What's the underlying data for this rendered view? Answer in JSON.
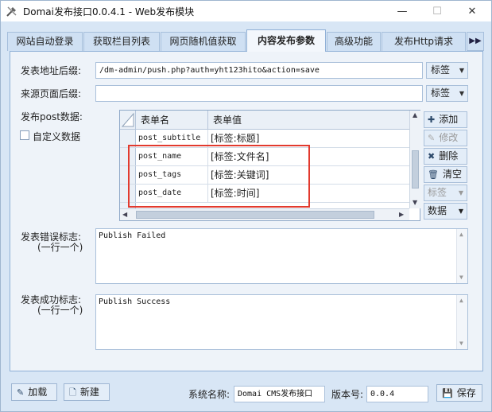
{
  "window": {
    "title": "Domai发布接口0.0.4.1 - Web发布模块",
    "min_icon": "—",
    "max_icon": "☐",
    "close_icon": "✕"
  },
  "tabs": [
    {
      "label": "网站自动登录"
    },
    {
      "label": "获取栏目列表"
    },
    {
      "label": "网页随机值获取"
    },
    {
      "label": "内容发布参数"
    },
    {
      "label": "高级功能"
    },
    {
      "label": "发布Http请求"
    }
  ],
  "tab_more": "▶▶",
  "form": {
    "post_url_label": "发表地址后缀:",
    "post_url_value": "/dm-admin/push.php?auth=yht123hito&action=save",
    "tag_btn_label": "标签",
    "source_page_label": "来源页面后缀:",
    "source_page_value": "",
    "post_data_label": "发布post数据:",
    "custom_data_label": "自定义数据"
  },
  "grid": {
    "col_name": "表单名",
    "col_value": "表单值",
    "rows": [
      {
        "name": "post_subtitle",
        "value": "[标签:标题]"
      },
      {
        "name": "post_name",
        "value": "[标签:文件名]"
      },
      {
        "name": "post_tags",
        "value": "[标签:关键词]"
      },
      {
        "name": "post_date",
        "value": "[标签:时间]"
      }
    ]
  },
  "side_buttons": {
    "add": "添加",
    "edit": "修改",
    "delete": "删除",
    "clear": "清空",
    "tag": "标签",
    "data": "数据"
  },
  "error": {
    "label_1": "发表错误标志:",
    "label_2": "(一行一个)",
    "value": "Publish Failed"
  },
  "success": {
    "label_1": "发表成功标志:",
    "label_2": "(一行一个)",
    "value": "Publish Success"
  },
  "bottom": {
    "load_label": "加载",
    "new_label": "新建",
    "system_name_label": "系统名称:",
    "system_name_value": "Domai CMS发布接口",
    "version_label": "版本号:",
    "version_value": "0.0.4",
    "save_label": "保存"
  }
}
